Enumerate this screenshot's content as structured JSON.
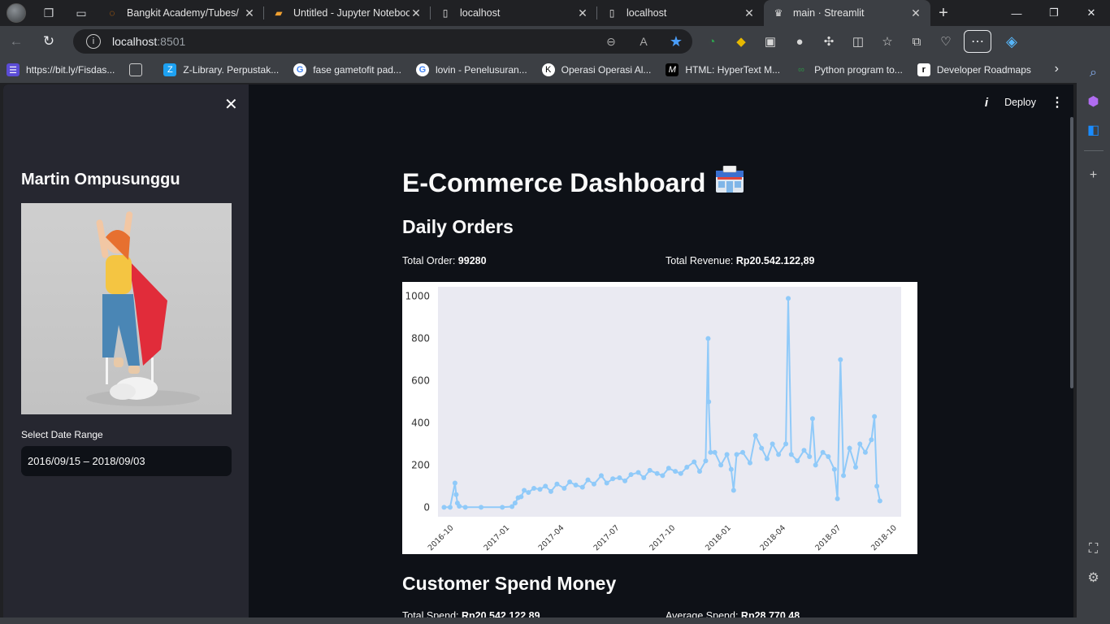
{
  "browser": {
    "tabs": [
      {
        "title": "Bangkit Academy/Tubes/",
        "favicon": "orange-ring-icon"
      },
      {
        "title": "Untitled - Jupyter Notebook",
        "favicon": "jupyter-book-icon"
      },
      {
        "title": "localhost",
        "favicon": "page-icon"
      },
      {
        "title": "localhost",
        "favicon": "page-icon"
      },
      {
        "title": "main · Streamlit",
        "favicon": "streamlit-crown-icon",
        "active": true
      }
    ],
    "address": {
      "host": "localhost",
      "port": ":8501"
    },
    "bookmarks": [
      {
        "label": "https://bit.ly/Fisdas..."
      },
      {
        "label": ""
      },
      {
        "label": "Z-Library. Perpustak..."
      },
      {
        "label": "fase gametofit pad..."
      },
      {
        "label": "lovin - Penelusuran..."
      },
      {
        "label": "Operasi Operasi Al..."
      },
      {
        "label": "HTML: HyperText M..."
      },
      {
        "label": "Python program to..."
      },
      {
        "label": "Developer Roadmaps"
      }
    ]
  },
  "app": {
    "deploy_label": "Deploy",
    "sidebar": {
      "name": "Martin Ompusunggu",
      "date_label": "Select Date Range",
      "date_value": "2016/09/15 – 2018/09/03"
    },
    "title": "E-Commerce Dashboard",
    "title_emoji": "convenience-store-icon",
    "section1": "Daily Orders",
    "total_order_label": "Total Order:",
    "total_order_value": "99280",
    "total_revenue_label": "Total Revenue:",
    "total_revenue_value": "Rp20.542.122,89",
    "section2": "Customer Spend Money",
    "total_spend_label": "Total Spend:",
    "total_spend_value": "Rp20.542.122,89",
    "avg_spend_label": "Average Spend:",
    "avg_spend_value": "Rp28.770,48"
  },
  "chart_data": {
    "type": "line",
    "title": "",
    "xlabel": "",
    "ylabel": "",
    "color": "#90caf9",
    "background": "#eaeaf2",
    "x_ticks": [
      "2016-10",
      "2017-01",
      "2017-04",
      "2017-07",
      "2017-10",
      "2018-01",
      "2018-04",
      "2018-07",
      "2018-10"
    ],
    "y_ticks": [
      0,
      200,
      400,
      600,
      800,
      1000
    ],
    "ylim": [
      -45,
      1045
    ],
    "xlim": [
      "2016-09-05",
      "2018-10-08"
    ],
    "series": [
      {
        "x": [
          "2016-09-15",
          "2016-09-25",
          "2016-10-03",
          "2016-10-05",
          "2016-10-07",
          "2016-10-10",
          "2016-10-20",
          "2016-11-15",
          "2016-12-20",
          "2017-01-05",
          "2017-01-10",
          "2017-01-15",
          "2017-01-20",
          "2017-01-25",
          "2017-02-01",
          "2017-02-10",
          "2017-02-20",
          "2017-03-01",
          "2017-03-10",
          "2017-03-20",
          "2017-04-01",
          "2017-04-10",
          "2017-04-20",
          "2017-05-01",
          "2017-05-10",
          "2017-05-20",
          "2017-06-01",
          "2017-06-10",
          "2017-06-20",
          "2017-07-01",
          "2017-07-10",
          "2017-07-20",
          "2017-08-01",
          "2017-08-10",
          "2017-08-20",
          "2017-09-01",
          "2017-09-10",
          "2017-09-20",
          "2017-10-01",
          "2017-10-10",
          "2017-10-20",
          "2017-11-01",
          "2017-11-10",
          "2017-11-20",
          "2017-11-24",
          "2017-11-25",
          "2017-11-28",
          "2017-12-05",
          "2017-12-15",
          "2017-12-25",
          "2018-01-01",
          "2018-01-05",
          "2018-01-10",
          "2018-01-20",
          "2018-02-01",
          "2018-02-10",
          "2018-02-20",
          "2018-03-01",
          "2018-03-10",
          "2018-03-20",
          "2018-04-01",
          "2018-04-05",
          "2018-04-10",
          "2018-04-20",
          "2018-05-01",
          "2018-05-10",
          "2018-05-15",
          "2018-05-20",
          "2018-06-01",
          "2018-06-10",
          "2018-06-20",
          "2018-06-25",
          "2018-06-30",
          "2018-07-05",
          "2018-07-15",
          "2018-07-25",
          "2018-08-01",
          "2018-08-10",
          "2018-08-20",
          "2018-08-25",
          "2018-08-29",
          "2018-09-03"
        ],
        "y": [
          0,
          0,
          115,
          60,
          20,
          5,
          0,
          0,
          0,
          3,
          20,
          45,
          50,
          80,
          70,
          90,
          85,
          100,
          75,
          110,
          90,
          120,
          105,
          95,
          130,
          110,
          150,
          115,
          135,
          140,
          125,
          155,
          165,
          140,
          175,
          160,
          150,
          185,
          170,
          160,
          190,
          215,
          170,
          220,
          800,
          500,
          260,
          260,
          200,
          250,
          180,
          80,
          250,
          260,
          210,
          340,
          280,
          230,
          300,
          250,
          300,
          990,
          250,
          220,
          270,
          240,
          420,
          200,
          260,
          240,
          180,
          40,
          700,
          150,
          280,
          190,
          300,
          260,
          320,
          430,
          100,
          30
        ]
      }
    ]
  }
}
